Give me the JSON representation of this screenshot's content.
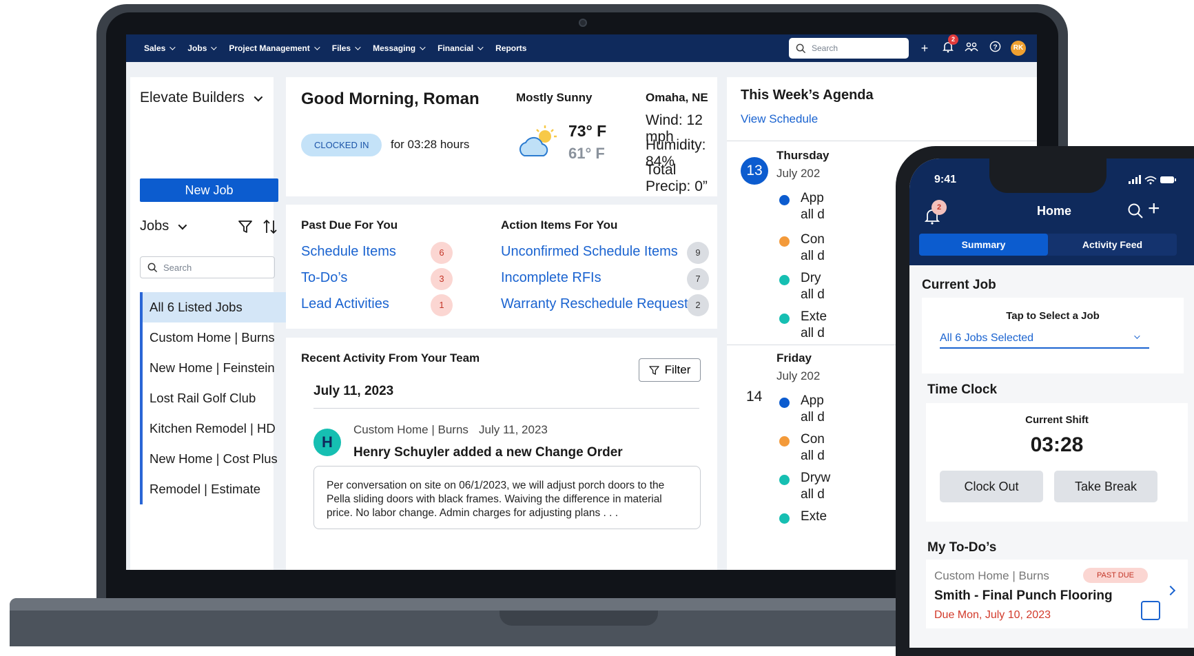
{
  "nav": {
    "items": [
      "Sales",
      "Jobs",
      "Project Management",
      "Files",
      "Messaging",
      "Financial",
      "Reports"
    ],
    "search_placeholder": "Search",
    "notif_count": "2",
    "avatar_initials": "RK"
  },
  "sidebar": {
    "company": "Elevate Builders",
    "new_job_label": "New Job",
    "jobs_label": "Jobs",
    "search_placeholder": "Search",
    "jobs": [
      "All 6 Listed Jobs",
      "Custom Home | Burns",
      "New Home | Feinstein",
      "Lost Rail Golf Club",
      "Kitchen Remodel | HD",
      "New Home | Cost Plus",
      "Remodel | Estimate"
    ],
    "active_job": "All 6 Listed Jobs"
  },
  "welcome": {
    "greeting": "Good Morning, Roman",
    "clock_status": "CLOCKED IN",
    "clock_hours": "for 03:28 hours",
    "weather_desc": "Mostly Sunny",
    "temp_high": "73° F",
    "temp_low": "61° F",
    "location": "Omaha, NE",
    "wind": "Wind: 12 mph",
    "humidity": "Humidity: 84%",
    "precip": "Total Precip: 0”"
  },
  "past_due": {
    "title": "Past Due For You",
    "items": [
      {
        "label": "Schedule Items",
        "count": "6"
      },
      {
        "label": "To-Do’s",
        "count": "3"
      },
      {
        "label": "Lead Activities",
        "count": "1"
      }
    ]
  },
  "action_items": {
    "title": "Action Items For You",
    "items": [
      {
        "label": "Unconfirmed Schedule Items",
        "count": "9"
      },
      {
        "label": "Incomplete RFIs",
        "count": "7"
      },
      {
        "label": "Warranty Reschedule Requests",
        "count": "2"
      }
    ]
  },
  "activity": {
    "title": "Recent Activity From Your Team",
    "filter_label": "Filter",
    "date": "July 11, 2023",
    "entry": {
      "avatar_letter": "H",
      "job": "Custom Home | Burns",
      "date": "July 11, 2023",
      "headline": "Henry Schuyler added a new Change Order",
      "body": "Per conversation on site on 06/1/2023, we will adjust porch doors to the Pella sliding doors with black frames. Waiving the difference in material price. No labor change. Admin charges for adjusting plans . . ."
    }
  },
  "agenda": {
    "title": "This Week’s Agenda",
    "link": "View Schedule",
    "days": [
      {
        "num": "13",
        "name": "Thursday",
        "date": "July 202",
        "items": [
          "App\nall d",
          "Con\nall d",
          "Dry\nall d",
          "Exte\nall d"
        ],
        "colors": [
          "#0c5ccf",
          "#f39a3a",
          "#16bfb2",
          "#16bfb2"
        ]
      },
      {
        "num": "14",
        "name": "Friday",
        "date": "July 202",
        "items": [
          "App\nall d",
          "Con\nall d",
          "Dryw\nall d",
          "Exte"
        ],
        "colors": [
          "#0c5ccf",
          "#f39a3a",
          "#16bfb2",
          "#16bfb2"
        ]
      }
    ]
  },
  "phone": {
    "time": "9:41",
    "notif_count": "2",
    "title": "Home",
    "tabs": [
      "Summary",
      "Activity Feed"
    ],
    "current_job_title": "Current Job",
    "tap_select": "Tap to Select a Job",
    "job_selected": "All 6 Jobs Selected",
    "time_clock_title": "Time Clock",
    "shift_label": "Current Shift",
    "shift_time": "03:28",
    "clock_out": "Clock Out",
    "take_break": "Take Break",
    "todos_title": "My To-Do’s",
    "todo": {
      "job": "Custom Home | Burns",
      "badge": "PAST DUE",
      "title": "Smith - Final Punch Flooring",
      "due": "Due Mon, July 10, 2023"
    }
  }
}
